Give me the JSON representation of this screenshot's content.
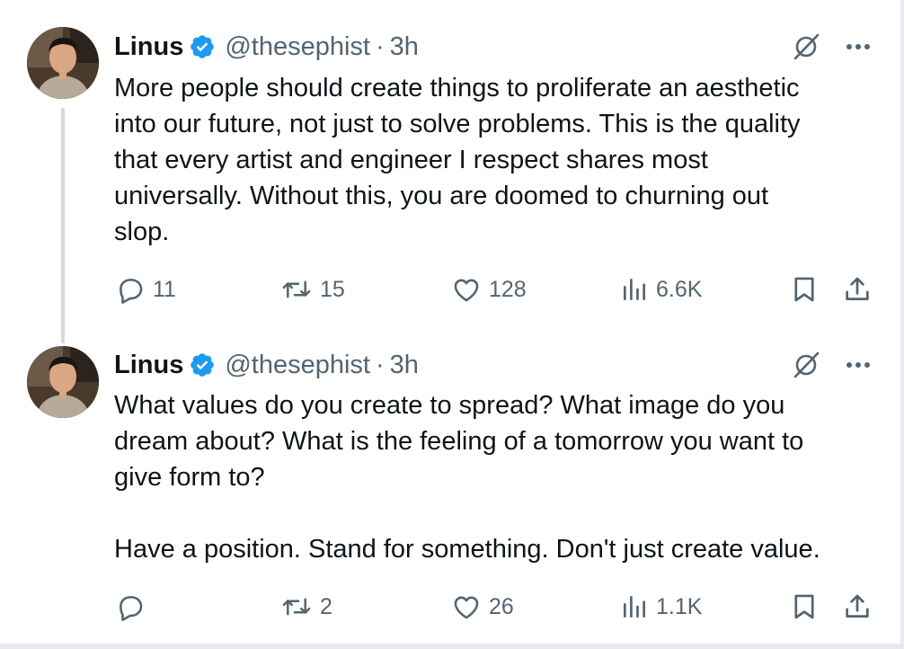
{
  "tweets": [
    {
      "author_name": "Linus",
      "handle": "@thesephist",
      "separator": "·",
      "time": "3h",
      "text": "More people should create things to proliferate an aesthetic\ninto our future, not just to solve problems. This is the quality\nthat every artist and engineer I respect shares most\nuniversally. Without this, you are doomed to churning out\nslop.",
      "replies": "11",
      "reposts": "15",
      "likes": "128",
      "views": "6.6K"
    },
    {
      "author_name": "Linus",
      "handle": "@thesephist",
      "separator": "·",
      "time": "3h",
      "text": "What values do you create to spread? What image do you\ndream about? What is the feeling of a tomorrow you want to\ngive form to?\n\nHave a position. Stand for something. Don't just create value.",
      "replies": "",
      "reposts": "2",
      "likes": "26",
      "views": "1.1K"
    }
  ],
  "icons": {
    "verified": "verified-badge-icon",
    "grok": "grok-icon",
    "more": "more-icon",
    "reply": "reply-icon",
    "repost": "repost-icon",
    "like": "like-icon",
    "views": "views-icon",
    "bookmark": "bookmark-icon",
    "share": "share-icon"
  },
  "colors": {
    "text": "#0f1419",
    "secondary": "#536471",
    "verified": "#1d9bf0",
    "thread_line": "#cfd9de"
  }
}
